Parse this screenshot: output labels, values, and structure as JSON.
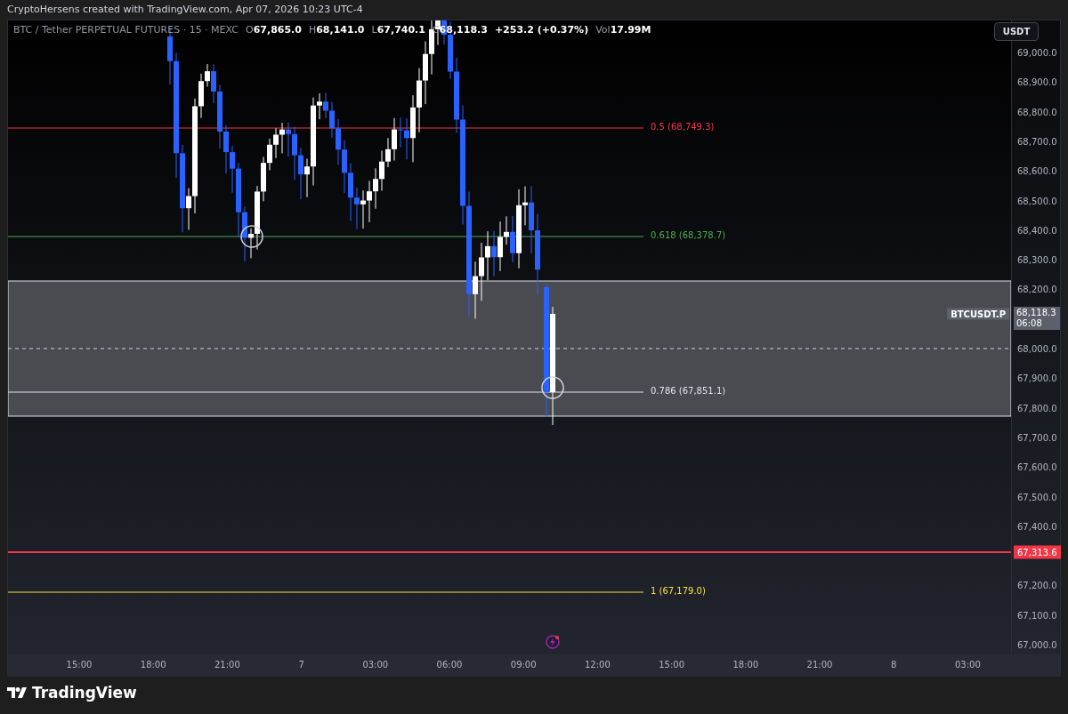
{
  "header": {
    "attribution": "CryptoHersens created with TradingView.com, Apr 07, 2026 10:23 UTC-4"
  },
  "legend": {
    "symbol": "BTC / Tether PERPETUAL FUTURES · 15 · MEXC",
    "ohlc": [
      {
        "label": "O",
        "value": "67,865.0"
      },
      {
        "label": "H",
        "value": "68,141.0"
      },
      {
        "label": "L",
        "value": "67,740.1"
      },
      {
        "label": "C",
        "value": "68,118.3"
      }
    ],
    "change": "+253.2 (+0.37%)",
    "volume": {
      "label": "Vol",
      "value": "17.99M"
    }
  },
  "price_axis": {
    "currency": "USDT",
    "ticks": [
      "69,000.0",
      "68,900.0",
      "68,800.0",
      "68,700.0",
      "68,600.0",
      "68,500.0",
      "68,400.0",
      "68,300.0",
      "68,200.0",
      "68,000.0",
      "67,900.0",
      "67,800.0",
      "67,700.0",
      "67,600.0",
      "67,500.0",
      "67,400.0",
      "67,200.0",
      "67,100.0",
      "67,000.0"
    ]
  },
  "fib_levels": [
    {
      "label": "0.5 (68,749.3)",
      "color": "#f23645"
    },
    {
      "label": "0.618 (68,378.7)",
      "color": "#4caf50"
    },
    {
      "label": "0.786 (67,851.1)",
      "color": "#e0e3eb"
    },
    {
      "label": "1 (67,179.0)",
      "color": "#f7e13b"
    }
  ],
  "alert_line": {
    "value": "67,313.6"
  },
  "current_price": {
    "symbol": "BTCUSDT.P",
    "price": "68,118.3",
    "countdown": "06:08"
  },
  "time_axis": {
    "ticks": [
      "15:00",
      "18:00",
      "21:00",
      "7",
      "03:00",
      "06:00",
      "09:00",
      "12:00",
      "15:00",
      "18:00",
      "21:00",
      "8",
      "03:00"
    ]
  },
  "footer": {
    "brand": "TradingView"
  }
}
